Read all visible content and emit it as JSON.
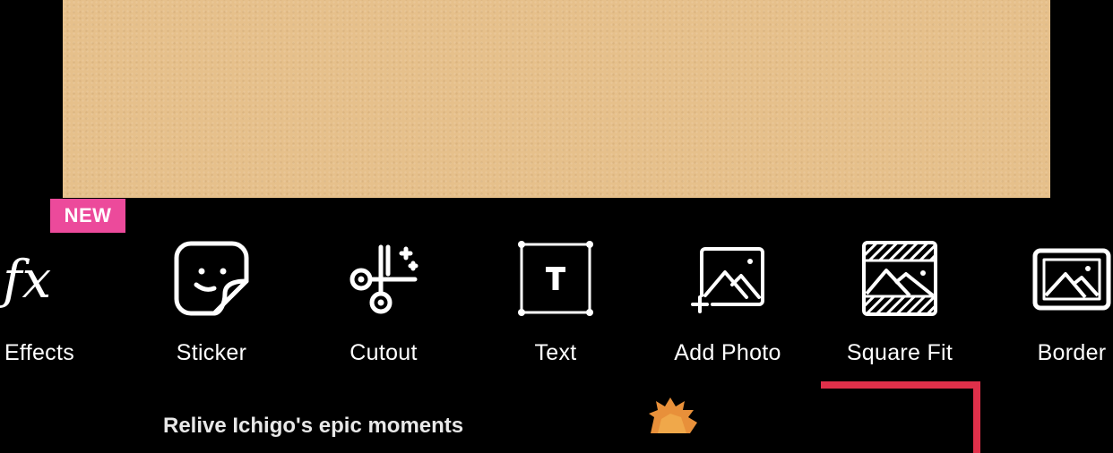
{
  "canvas": {
    "background_color": "#e6c08b"
  },
  "toolbar": {
    "new_badge": "NEW",
    "badge_color": "#ec4a9b",
    "tools": [
      {
        "id": "effects",
        "label": "Effects",
        "icon": "fx-icon"
      },
      {
        "id": "sticker",
        "label": "Sticker",
        "icon": "sticker-icon"
      },
      {
        "id": "cutout",
        "label": "Cutout",
        "icon": "scissors-icon"
      },
      {
        "id": "text",
        "label": "Text",
        "icon": "text-box-icon"
      },
      {
        "id": "add-photo",
        "label": "Add Photo",
        "icon": "add-photo-icon"
      },
      {
        "id": "square-fit",
        "label": "Square Fit",
        "icon": "square-fit-icon"
      },
      {
        "id": "border",
        "label": "Border",
        "icon": "border-icon"
      }
    ]
  },
  "promo": {
    "text": "Relive Ichigo's epic moments",
    "accent_color": "#e0304a"
  }
}
